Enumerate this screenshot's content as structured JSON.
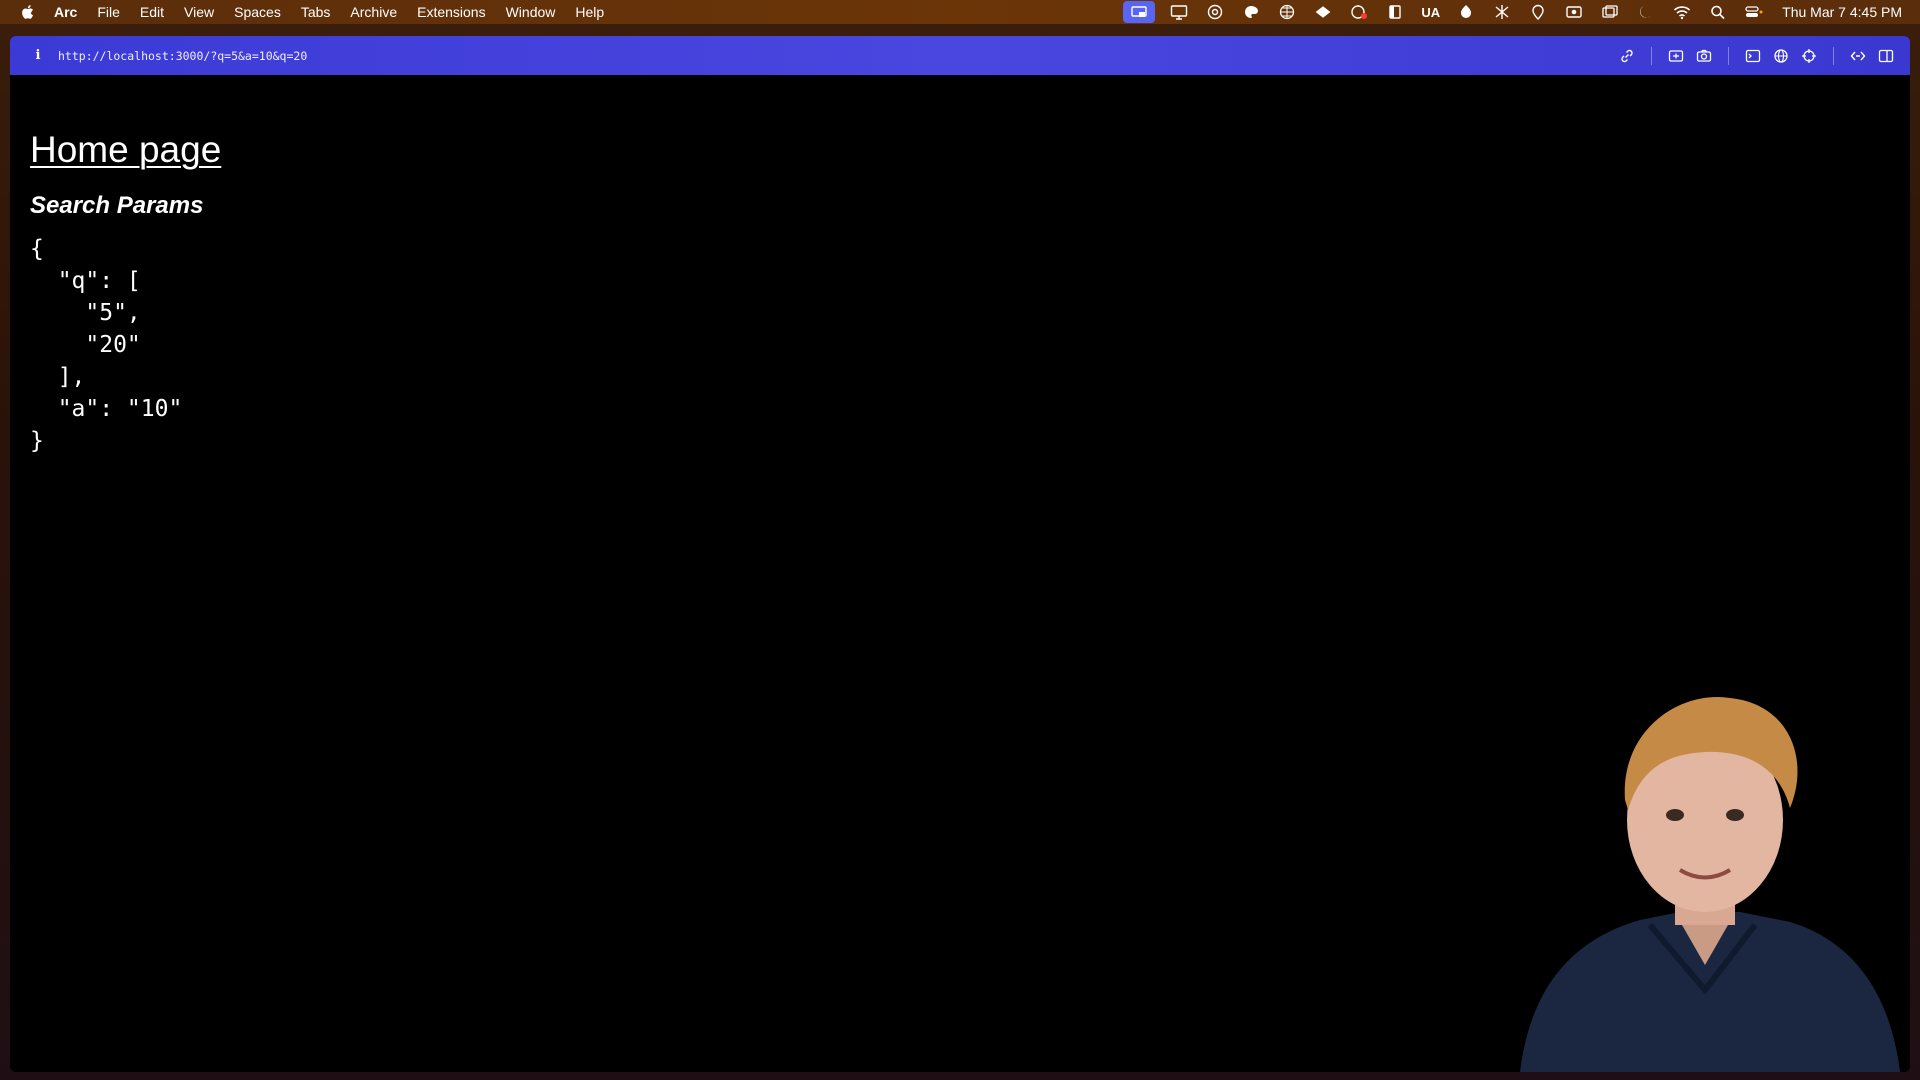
{
  "menubar": {
    "app_name": "Arc",
    "menus": [
      "File",
      "Edit",
      "View",
      "Spaces",
      "Tabs",
      "Archive",
      "Extensions",
      "Window",
      "Help"
    ],
    "tray_text": "UA",
    "clock": "Thu Mar 7  4:45 PM"
  },
  "browser": {
    "url": "http://localhost:3000/?q=5&a=10&q=20",
    "accent": "#4140db"
  },
  "page": {
    "home_link": "Home page",
    "section_title": "Search Params",
    "json_lines": [
      "{",
      "  \"q\": [",
      "    \"5\",",
      "    \"20\"",
      "  ],",
      "  \"a\": \"10\"",
      "}"
    ]
  }
}
